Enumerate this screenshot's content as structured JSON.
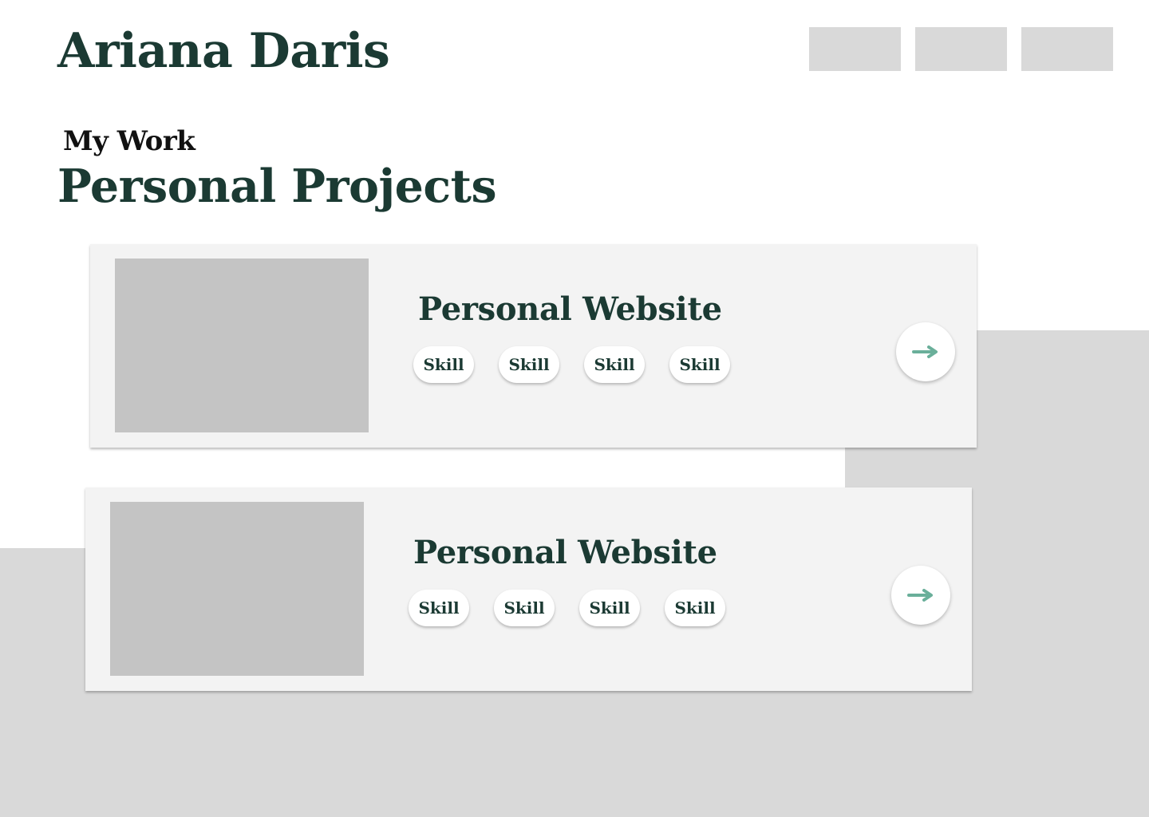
{
  "header": {
    "name": "Ariana Daris",
    "nav": [
      "",
      "",
      ""
    ]
  },
  "section": {
    "eyebrow": "My Work",
    "title": "Personal Projects"
  },
  "projects": [
    {
      "title": "Personal Website",
      "skills": [
        "Skill",
        "Skill",
        "Skill",
        "Skill"
      ],
      "action_icon": "arrow-right-icon"
    },
    {
      "title": "Personal Website",
      "skills": [
        "Skill",
        "Skill",
        "Skill",
        "Skill"
      ],
      "action_icon": "arrow-right-icon"
    }
  ],
  "colors": {
    "primary_text": "#1b3a33",
    "accent_arrow": "#6aaf9a",
    "card_bg": "#f3f3f3",
    "placeholder": "#c4c4c4",
    "background_block": "#d9d9d9"
  }
}
